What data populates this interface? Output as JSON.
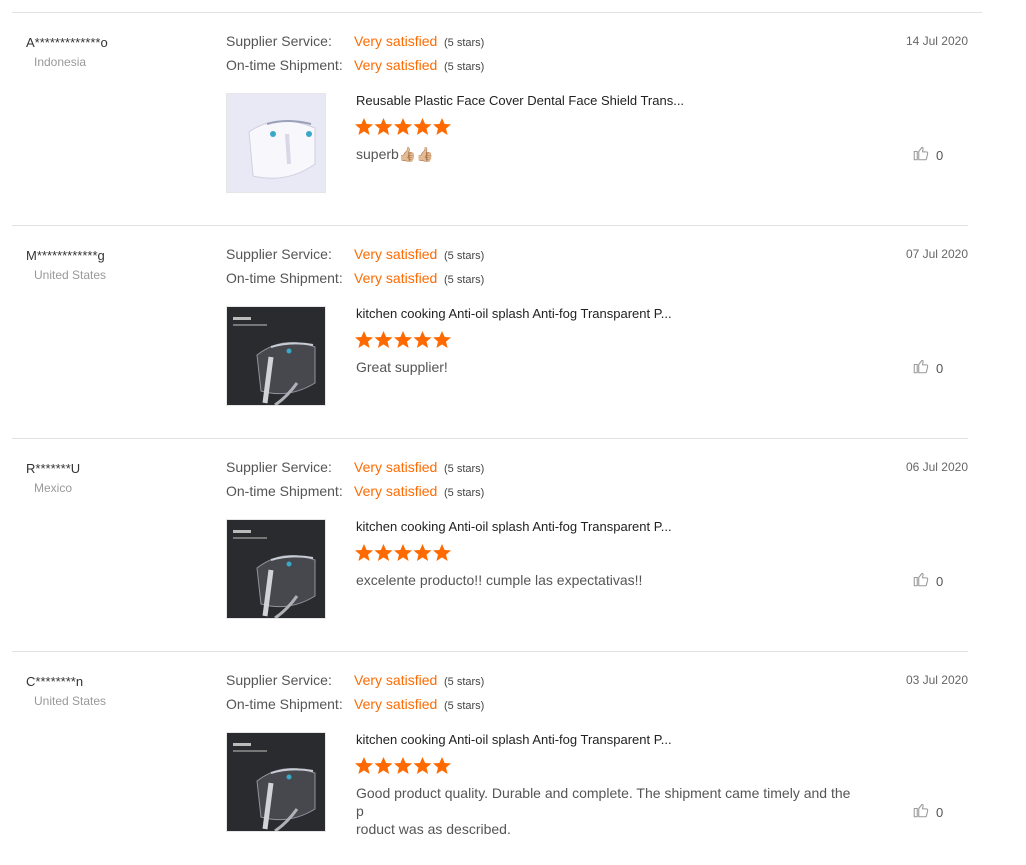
{
  "colors": {
    "accent": "#ff6a00"
  },
  "reviews": [
    {
      "buyer": "A*************o",
      "country": "Indonesia",
      "supplier_label": "Supplier Service:",
      "supplier_value": "Very satisfied",
      "supplier_stars": "(5 stars)",
      "shipment_label": "On-time Shipment:",
      "shipment_value": "Very satisfied",
      "shipment_stars": "(5 stars)",
      "date": "14 Jul 2020",
      "product_title": "Reusable Plastic Face Cover Dental Face Shield Trans...",
      "product_rating": 5,
      "product_image": "clear-face-shield-light",
      "comment": "superb👍🏼👍🏼",
      "helpful_icon": "thumbs-up-icon",
      "helpful_count": "0"
    },
    {
      "buyer": "M************g",
      "country": "United States",
      "supplier_label": "Supplier Service:",
      "supplier_value": "Very satisfied",
      "supplier_stars": "(5 stars)",
      "shipment_label": "On-time Shipment:",
      "shipment_value": "Very satisfied",
      "shipment_stars": "(5 stars)",
      "date": "07 Jul 2020",
      "product_title": "kitchen cooking Anti-oil splash Anti-fog Transparent P...",
      "product_rating": 5,
      "product_image": "face-shield-dark-background",
      "comment": "Great supplier!",
      "helpful_icon": "thumbs-up-icon",
      "helpful_count": "0"
    },
    {
      "buyer": "R*******U",
      "country": "Mexico",
      "supplier_label": "Supplier Service:",
      "supplier_value": "Very satisfied",
      "supplier_stars": "(5 stars)",
      "shipment_label": "On-time Shipment:",
      "shipment_value": "Very satisfied",
      "shipment_stars": "(5 stars)",
      "date": "06 Jul 2020",
      "product_title": "kitchen cooking Anti-oil splash Anti-fog Transparent P...",
      "product_rating": 5,
      "product_image": "face-shield-dark-background",
      "comment": "excelente producto!! cumple las expectativas!!",
      "helpful_icon": "thumbs-up-icon",
      "helpful_count": "0"
    },
    {
      "buyer": "C********n",
      "country": "United States",
      "supplier_label": "Supplier Service:",
      "supplier_value": "Very satisfied",
      "supplier_stars": "(5 stars)",
      "shipment_label": "On-time Shipment:",
      "shipment_value": "Very satisfied",
      "shipment_stars": "(5 stars)",
      "date": "03 Jul 2020",
      "product_title": "kitchen cooking Anti-oil splash Anti-fog Transparent P...",
      "product_rating": 5,
      "product_image": "face-shield-dark-background",
      "comment": "Good product quality. Durable and complete. The shipment came timely and the p\nroduct was as described.",
      "helpful_icon": "thumbs-up-icon",
      "helpful_count": "0"
    }
  ]
}
